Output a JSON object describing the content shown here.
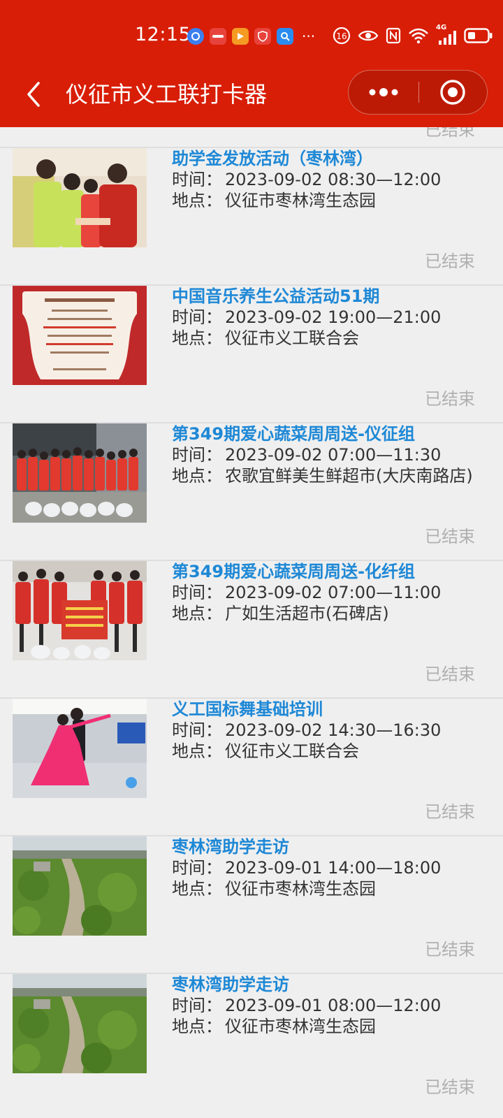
{
  "status_bar": {
    "time": "12:15",
    "network": "4G"
  },
  "title_bar": {
    "title": "仪征市义工联打卡器"
  },
  "partial_item": {
    "status": "已结束"
  },
  "events": [
    {
      "title": "助学金发放活动（枣林湾）",
      "time_label": "时间：",
      "time": "2023-09-02 08:30—12:00",
      "place_label": "地点：",
      "place": "仪征市枣林湾生态园",
      "status": "已结束",
      "image": "volunteers-handing-out-photo"
    },
    {
      "title": "中国音乐养生公益活动51期",
      "time_label": "时间：",
      "time": "2023-09-02 19:00—21:00",
      "place_label": "地点：",
      "place": "仪征市义工联合会",
      "status": "已结束",
      "image": "poster-photo"
    },
    {
      "title": "第349期爱心蔬菜周周送-仪征组",
      "time_label": "时间：",
      "time": "2023-09-02 07:00—11:30",
      "place_label": "地点：",
      "place": "农歌宜鲜美生鲜超市(大庆南路店)",
      "status": "已结束",
      "image": "group-vegetables-photo"
    },
    {
      "title": "第349期爱心蔬菜周周送-化纤组",
      "time_label": "时间：",
      "time": "2023-09-02 07:00—11:00",
      "place_label": "地点：",
      "place": "广如生活超市(石碑店)",
      "status": "已结束",
      "image": "group-banner-photo"
    },
    {
      "title": "义工国标舞基础培训",
      "time_label": "时间：",
      "time": "2023-09-02 14:30—16:30",
      "place_label": "地点：",
      "place": "仪征市义工联合会",
      "status": "已结束",
      "image": "dance-photo"
    },
    {
      "title": "枣林湾助学走访",
      "time_label": "时间：",
      "time": "2023-09-01 14:00—18:00",
      "place_label": "地点：",
      "place": "仪征市枣林湾生态园",
      "status": "已结束",
      "image": "field-path-photo"
    },
    {
      "title": "枣林湾助学走访",
      "time_label": "时间：",
      "time": "2023-09-01 08:00—12:00",
      "place_label": "地点：",
      "place": "仪征市枣林湾生态园",
      "status": "已结束",
      "image": "field-path-photo"
    }
  ],
  "colors": {
    "header_bg": "#d81e06",
    "title_link": "#1e88d6",
    "status_gray": "#b0b0b0",
    "page_bg": "#efefef"
  }
}
